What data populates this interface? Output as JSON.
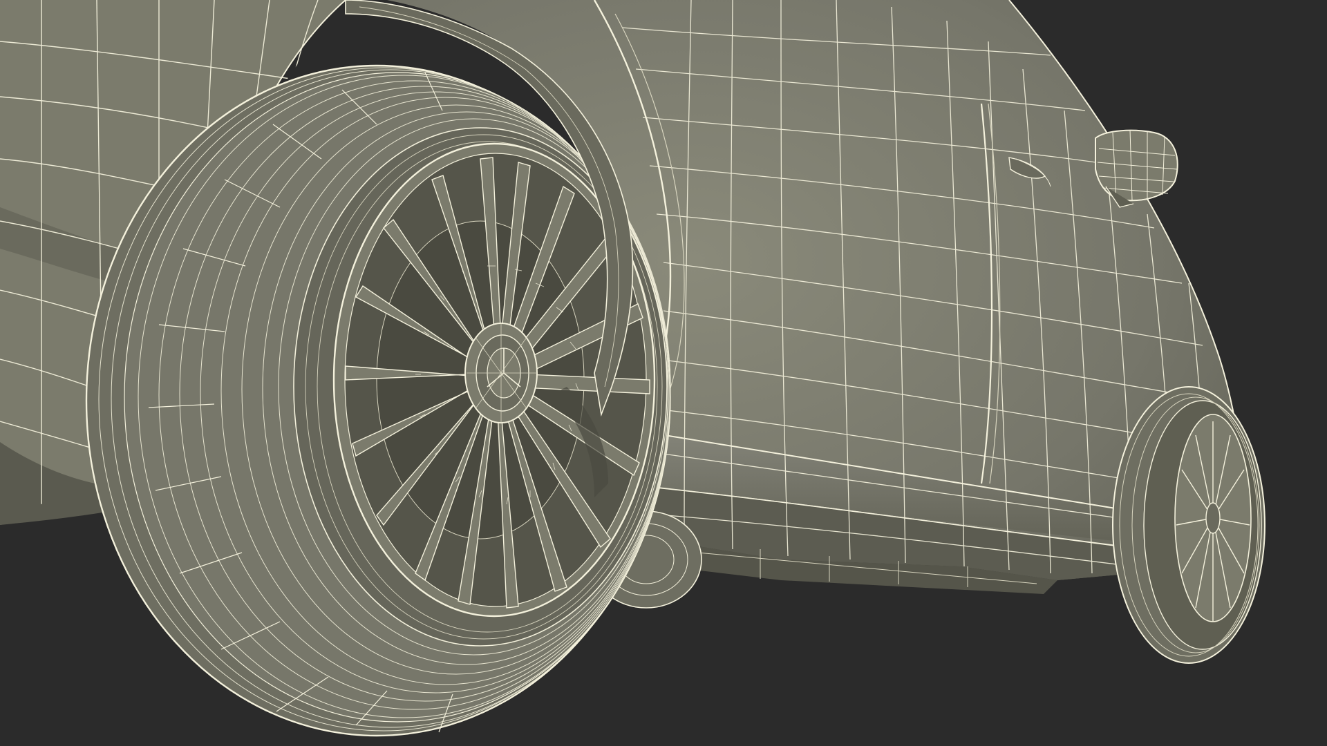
{
  "scene": {
    "subject": "car-wireframe-render",
    "colors": {
      "background": "#2b2b2b",
      "surface": "#7b7b6c",
      "surface_dark": "#5f5f52",
      "surface_shadow": "#4a4a40",
      "wire": "#f4f1dc",
      "wire_dim": "#d8d5bf",
      "tire": "#6e6e61",
      "tire_dark": "#55554a"
    },
    "icons": {
      "front_wheel": "wheel-icon",
      "rear_wheel": "wheel-icon",
      "mirror": "side-mirror-icon",
      "hub": "hub-emblem-icon"
    }
  }
}
